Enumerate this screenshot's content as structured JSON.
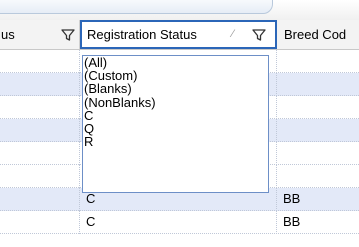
{
  "columns": {
    "status": {
      "label": "us"
    },
    "registration": {
      "label": "Registration Status",
      "sort_glyph": "⁄"
    },
    "breed": {
      "label": "Breed Cod"
    }
  },
  "filter_options": [
    "(All)",
    "(Custom)",
    "(Blanks)",
    "(NonBlanks)",
    "C",
    "Q",
    "R"
  ],
  "rows": [
    {
      "status": "",
      "registration": "",
      "breed": ""
    },
    {
      "status": "",
      "registration": "",
      "breed": ""
    },
    {
      "status": "",
      "registration": "",
      "breed": ""
    },
    {
      "status": "",
      "registration": "",
      "breed": ""
    },
    {
      "status": "",
      "registration": "",
      "breed": ""
    },
    {
      "status": "",
      "registration": "",
      "breed": ""
    },
    {
      "status": "",
      "registration": "C",
      "breed": "BB"
    },
    {
      "status": "",
      "registration": "C",
      "breed": "BB"
    }
  ],
  "colors": {
    "selected_header_border": "#2b66b8",
    "alt_row": "#e3e9f8"
  },
  "icons": {
    "filter": "funnel-icon"
  }
}
